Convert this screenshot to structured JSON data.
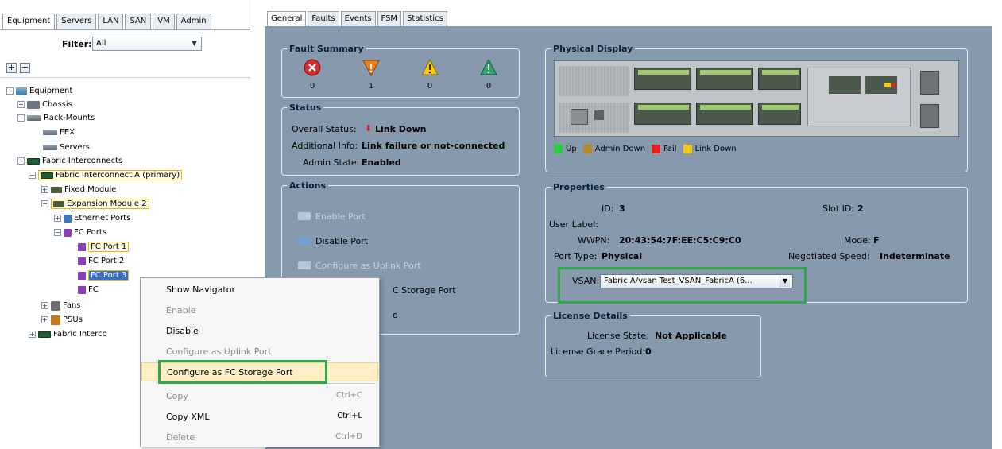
{
  "left": {
    "tabs": [
      "Equipment",
      "Servers",
      "LAN",
      "SAN",
      "VM",
      "Admin"
    ],
    "filter_label": "Filter:",
    "filter_value": "All",
    "expand_all": "+",
    "collapse_all": "−",
    "tree": {
      "equipment": "Equipment",
      "chassis": "Chassis",
      "rack_mounts": "Rack-Mounts",
      "fex": "FEX",
      "servers": "Servers",
      "fabric_interconnects": "Fabric Interconnects",
      "fi_a": "Fabric Interconnect A (primary)",
      "fixed_module": "Fixed Module",
      "expansion_module": "Expansion Module 2",
      "ethernet_ports": "Ethernet Ports",
      "fc_ports": "FC Ports",
      "fc_port_1": "FC Port 1",
      "fc_port_2": "FC Port 2",
      "fc_port_3": "FC Port 3",
      "fc_port_4": "FC",
      "fans": "Fans",
      "psus": "PSUs",
      "fi_b": "Fabric Interco"
    }
  },
  "context_menu": {
    "items": [
      {
        "label": "Show Navigator",
        "shortcut": "",
        "enabled": true
      },
      {
        "label": "Enable",
        "shortcut": "",
        "enabled": false
      },
      {
        "label": "Disable",
        "shortcut": "",
        "enabled": true
      },
      {
        "label": "Configure as Uplink Port",
        "shortcut": "",
        "enabled": false
      },
      {
        "label": "Configure as FC Storage Port",
        "shortcut": "",
        "enabled": true
      },
      {
        "label": "Copy",
        "shortcut": "Ctrl+C",
        "enabled": false
      },
      {
        "label": "Copy XML",
        "shortcut": "Ctrl+L",
        "enabled": true
      },
      {
        "label": "Delete",
        "shortcut": "Ctrl+D",
        "enabled": false
      }
    ]
  },
  "right": {
    "tabs": [
      "General",
      "Faults",
      "Events",
      "FSM",
      "Statistics"
    ],
    "fault_summary": {
      "title": "Fault Summary",
      "critical": "0",
      "major": "1",
      "minor": "0",
      "warning": "0"
    },
    "status": {
      "title": "Status",
      "overall_label": "Overall Status:",
      "overall_value": "Link Down",
      "additional_label": "Additional Info:",
      "additional_value": "Link failure or not-connected",
      "admin_label": "Admin State:",
      "admin_value": "Enabled"
    },
    "actions": {
      "title": "Actions",
      "enable_port": "Enable Port",
      "disable_port": "Disable Port",
      "configure_uplink": "Configure as Uplink Port",
      "configure_fc_storage": "C Storage Port",
      "partial": "o"
    },
    "physical_display": {
      "title": "Physical Display",
      "legend": [
        {
          "label": "Up",
          "color": "#2ecc40"
        },
        {
          "label": "Admin Down",
          "color": "#b8892b"
        },
        {
          "label": "Fail",
          "color": "#e02020"
        },
        {
          "label": "Link Down",
          "color": "#f2c81a"
        }
      ]
    },
    "properties": {
      "title": "Properties",
      "id_label": "ID:",
      "id_value": "3",
      "slot_label": "Slot ID:",
      "slot_value": "2",
      "user_label_label": "User Label:",
      "wwpn_label": "WWPN:",
      "wwpn_value": "20:43:54:7F:EE:C5:C9:C0",
      "mode_label": "Mode:",
      "mode_value": "F",
      "port_type_label": "Port Type:",
      "port_type_value": "Physical",
      "neg_speed_label": "Negotiated Speed:",
      "neg_speed_value": "Indeterminate",
      "vsan_label": "VSAN:",
      "vsan_value": "Fabric A/vsan Test_VSAN_FabricA (6..."
    },
    "license": {
      "title": "License Details",
      "state_label": "License State:",
      "state_value": "Not Applicable",
      "grace_label": "License Grace Period:",
      "grace_value": "0"
    }
  },
  "colors": {
    "panel_bg": "#8699ad",
    "highlight_green": "#2fa64a",
    "tree_highlight": "#e5b71a"
  }
}
